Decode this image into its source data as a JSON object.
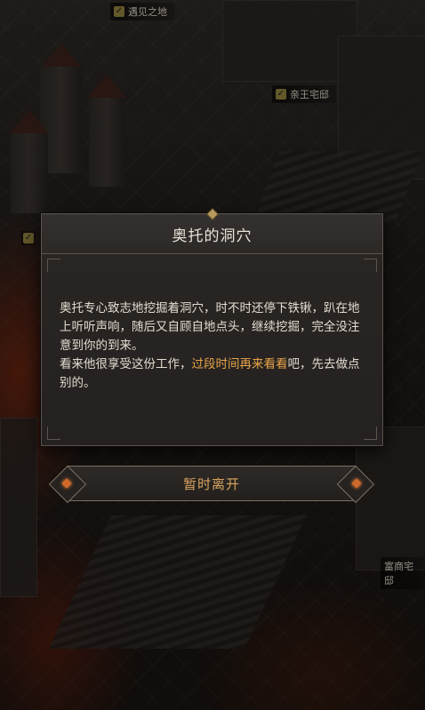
{
  "map": {
    "labels": [
      {
        "text": "遇见之地",
        "visited": true
      },
      {
        "text": "亲王宅邸",
        "visited": true
      },
      {
        "text": "富商宅邸",
        "visited": false
      }
    ]
  },
  "dialog": {
    "title": "奥托的洞穴",
    "paragraph1": "奥托专心致志地挖掘着洞穴，时不时还停下铁锹，趴在地上听听声响，随后又自顾自地点头，继续挖掘，完全没注意到你的到来。",
    "paragraph2_prefix": "看来他很享受这份工作，",
    "paragraph2_highlight": "过段时间再来看看",
    "paragraph2_suffix": "吧，先去做点别的。",
    "highlight_color": "#e8a44a"
  },
  "actions": {
    "leave_label": "暂时离开"
  }
}
